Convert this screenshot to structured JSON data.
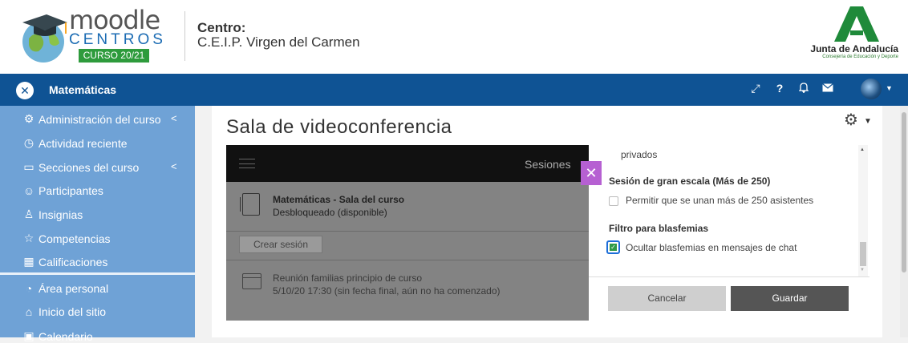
{
  "header": {
    "logo": {
      "word": "moodle",
      "sub": "CENTROS",
      "badge": "CURSO 20/21"
    },
    "centro_label": "Centro:",
    "centro_name": "C.E.I.P. Virgen del Carmen",
    "junta": {
      "name": "Junta de Andalucía",
      "sub": "Consejería de Educación y Deporte"
    }
  },
  "navbar": {
    "close_icon": "close-icon",
    "title": "Matemáticas",
    "icons": [
      "expand-icon",
      "help-icon",
      "bell-icon",
      "envelope-icon",
      "avatar"
    ],
    "color": "#0f5394"
  },
  "sidebar": {
    "items": [
      {
        "label": "Administración del curso",
        "icon": "gears-icon",
        "arrow": "<"
      },
      {
        "label": "Actividad reciente",
        "icon": "clock-icon"
      },
      {
        "label": "Secciones del curso",
        "icon": "folder-icon",
        "arrow": "<"
      },
      {
        "label": "Participantes",
        "icon": "users-icon"
      },
      {
        "label": "Insignias",
        "icon": "badge-icon"
      },
      {
        "label": "Competencias",
        "icon": "star-icon"
      },
      {
        "label": "Calificaciones",
        "icon": "grades-icon"
      },
      {
        "label": "Área personal",
        "icon": "gauge-icon"
      },
      {
        "label": "Inicio del sitio",
        "icon": "home-icon"
      },
      {
        "label": "Calendario",
        "icon": "calendar-icon"
      }
    ],
    "color": "#6fa2d6"
  },
  "main": {
    "title": "Sala de videoconferencia",
    "panel": {
      "sessions_label": "Sesiones",
      "room_name": "Matemáticas - Sala del curso",
      "room_status": "Desbloqueado (disponible)",
      "create_button": "Crear sesión",
      "meeting_title": "Reunión familias principio de curso",
      "meeting_date": "5/10/20 17:30 (sin fecha final, aún no ha comenzado)"
    },
    "modal": {
      "partial_text": "privados",
      "section1_title": "Sesión de gran escala (Más de 250)",
      "section1_option": "Permitir que se unan más de 250 asistentes",
      "section1_checked": false,
      "section2_title": "Filtro para blasfemias",
      "section2_option": "Ocultar blasfemias en mensajes de chat",
      "section2_checked": true,
      "cancel": "Cancelar",
      "save": "Guardar"
    }
  }
}
